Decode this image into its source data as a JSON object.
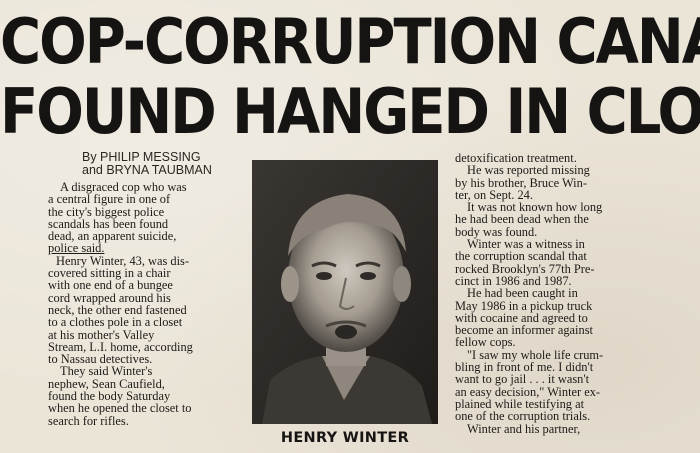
{
  "headline": {
    "line1": "COP-CORRUPTION CANARY",
    "line2": "FOUND HANGED IN CLOSET"
  },
  "byline": {
    "line1": "By PHILIP MESSING",
    "line2": "and BRYNA TAUBMAN"
  },
  "column1": {
    "lines": [
      "A disgraced cop who was",
      "a central figure in one of",
      "the city's biggest police",
      "scandals has been found",
      "dead, an apparent suicide,",
      "police said.",
      "Henry Winter, 43, was dis-",
      "covered sitting in a chair",
      "with one end of a bungee",
      "cord wrapped around his",
      "neck, the other end fastened",
      "to a clothes pole in a closet",
      "at his mother's Valley",
      "Stream, L.I. home, according",
      "to Nassau detectives.",
      "They said Winter's",
      "nephew, Sean Caufield,",
      "found the body Saturday",
      "when he opened the closet to",
      "search for rifles."
    ]
  },
  "column3": {
    "lines": [
      "detoxification treatment.",
      "He was reported missing",
      "by his brother, Bruce Win-",
      "ter, on Sept. 24.",
      "It was not known how long",
      "he had been dead when the",
      "body was found.",
      "Winter was a witness in",
      "the corruption scandal that",
      "rocked Brooklyn's 77th Pre-",
      "cinct in 1986 and 1987.",
      "He had been caught in",
      "May 1986 in a pickup truck",
      "with cocaine and agreed to",
      "become an informer against",
      "fellow cops.",
      "\"I saw my whole life crum-",
      "bling in front of me. I didn't",
      "want to go jail . . . it wasn't",
      "an easy decision,\" Winter ex-",
      "plained while testifying at",
      "one of the corruption trials.",
      "Winter and his partner,"
    ]
  },
  "photo": {
    "caption": "HENRY WINTER"
  }
}
